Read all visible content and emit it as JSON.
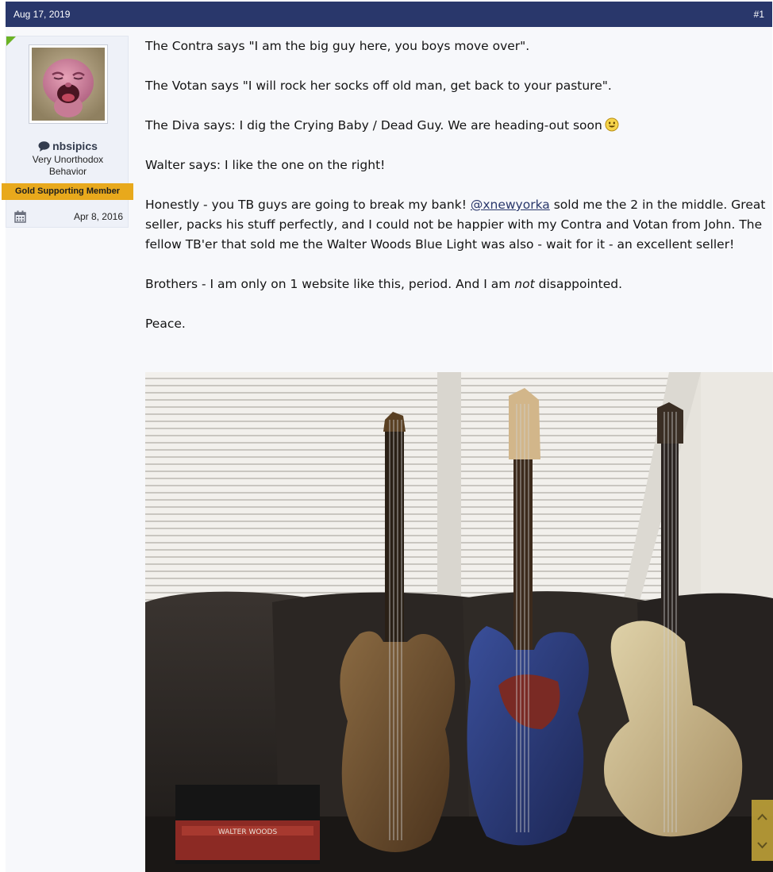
{
  "post": {
    "date": "Aug 17, 2019",
    "number": "#1"
  },
  "user": {
    "name": "nbsipics",
    "title": "Very Unorthodox Behavior",
    "banner": "Gold Supporting Member",
    "joined": "Apr 8, 2016",
    "online_color": "#6bb324"
  },
  "message": {
    "p1": "The Contra says \"I am the big guy here, you boys move over\".",
    "p2": "The Votan says \"I will rock her socks off old man, get back to your pasture\".",
    "p3": "The Diva says: I dig the Crying Baby / Dead Guy. We are heading-out soon",
    "p4": "Walter says: I like the one on the right!",
    "p5_before": "Honestly - you TB guys are going to break my bank! ",
    "p5_mention": "@xnewyorka",
    "p5_after": " sold me the 2 in the middle. Great seller, packs his stuff perfectly, and I could not be happier with my Contra and Votan from John. The fellow TB'er that sold me the Walter Woods Blue Light was also - wait for it - an excellent seller!",
    "p6_before": "Brothers - I am only on 1 website like this, period. And I am ",
    "p6_em": "not",
    "p6_after": " disappointed.",
    "p7": "Peace."
  },
  "photo": {
    "amp_label": "WALTER WOODS"
  },
  "colors": {
    "header_bg": "#29376b",
    "banner_bg": "#e8a91c",
    "link": "#29376b"
  }
}
